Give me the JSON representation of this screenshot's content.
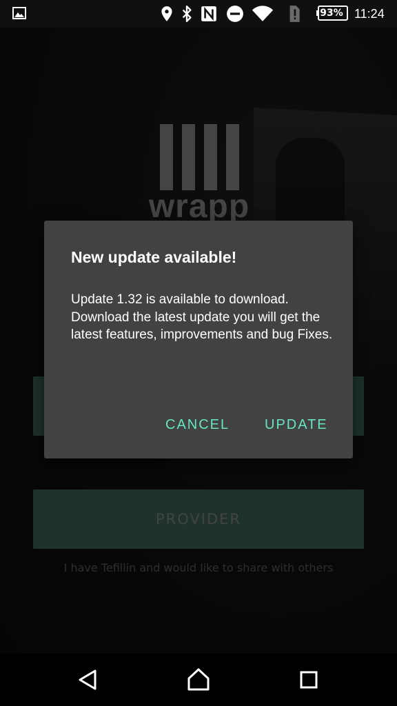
{
  "status_bar": {
    "battery_percent": "93%",
    "time": "11:24",
    "icons": [
      "gallery-icon",
      "location-icon",
      "bluetooth-icon",
      "nfc-icon",
      "do-not-disturb-icon",
      "wifi-icon",
      "sim-alert-icon",
      "battery-icon"
    ]
  },
  "app": {
    "logo_text": "wrapp",
    "provider_button": "PROVIDER",
    "provider_caption": "I have Tefillin and would like to share with others",
    "colors": {
      "button_green": "#3a5c51",
      "logo_gray": "#7c7c7c"
    }
  },
  "dialog": {
    "title": "New update available!",
    "message": "Update 1.32 is available to download. Download the latest update you will get the latest features, improvements and bug Fixes.",
    "cancel_label": "CANCEL",
    "update_label": "UPDATE",
    "colors": {
      "background": "#424242",
      "accent": "#66e6c4"
    }
  },
  "nav_bar": {
    "icons": [
      "back-icon",
      "home-icon",
      "recents-icon"
    ]
  }
}
